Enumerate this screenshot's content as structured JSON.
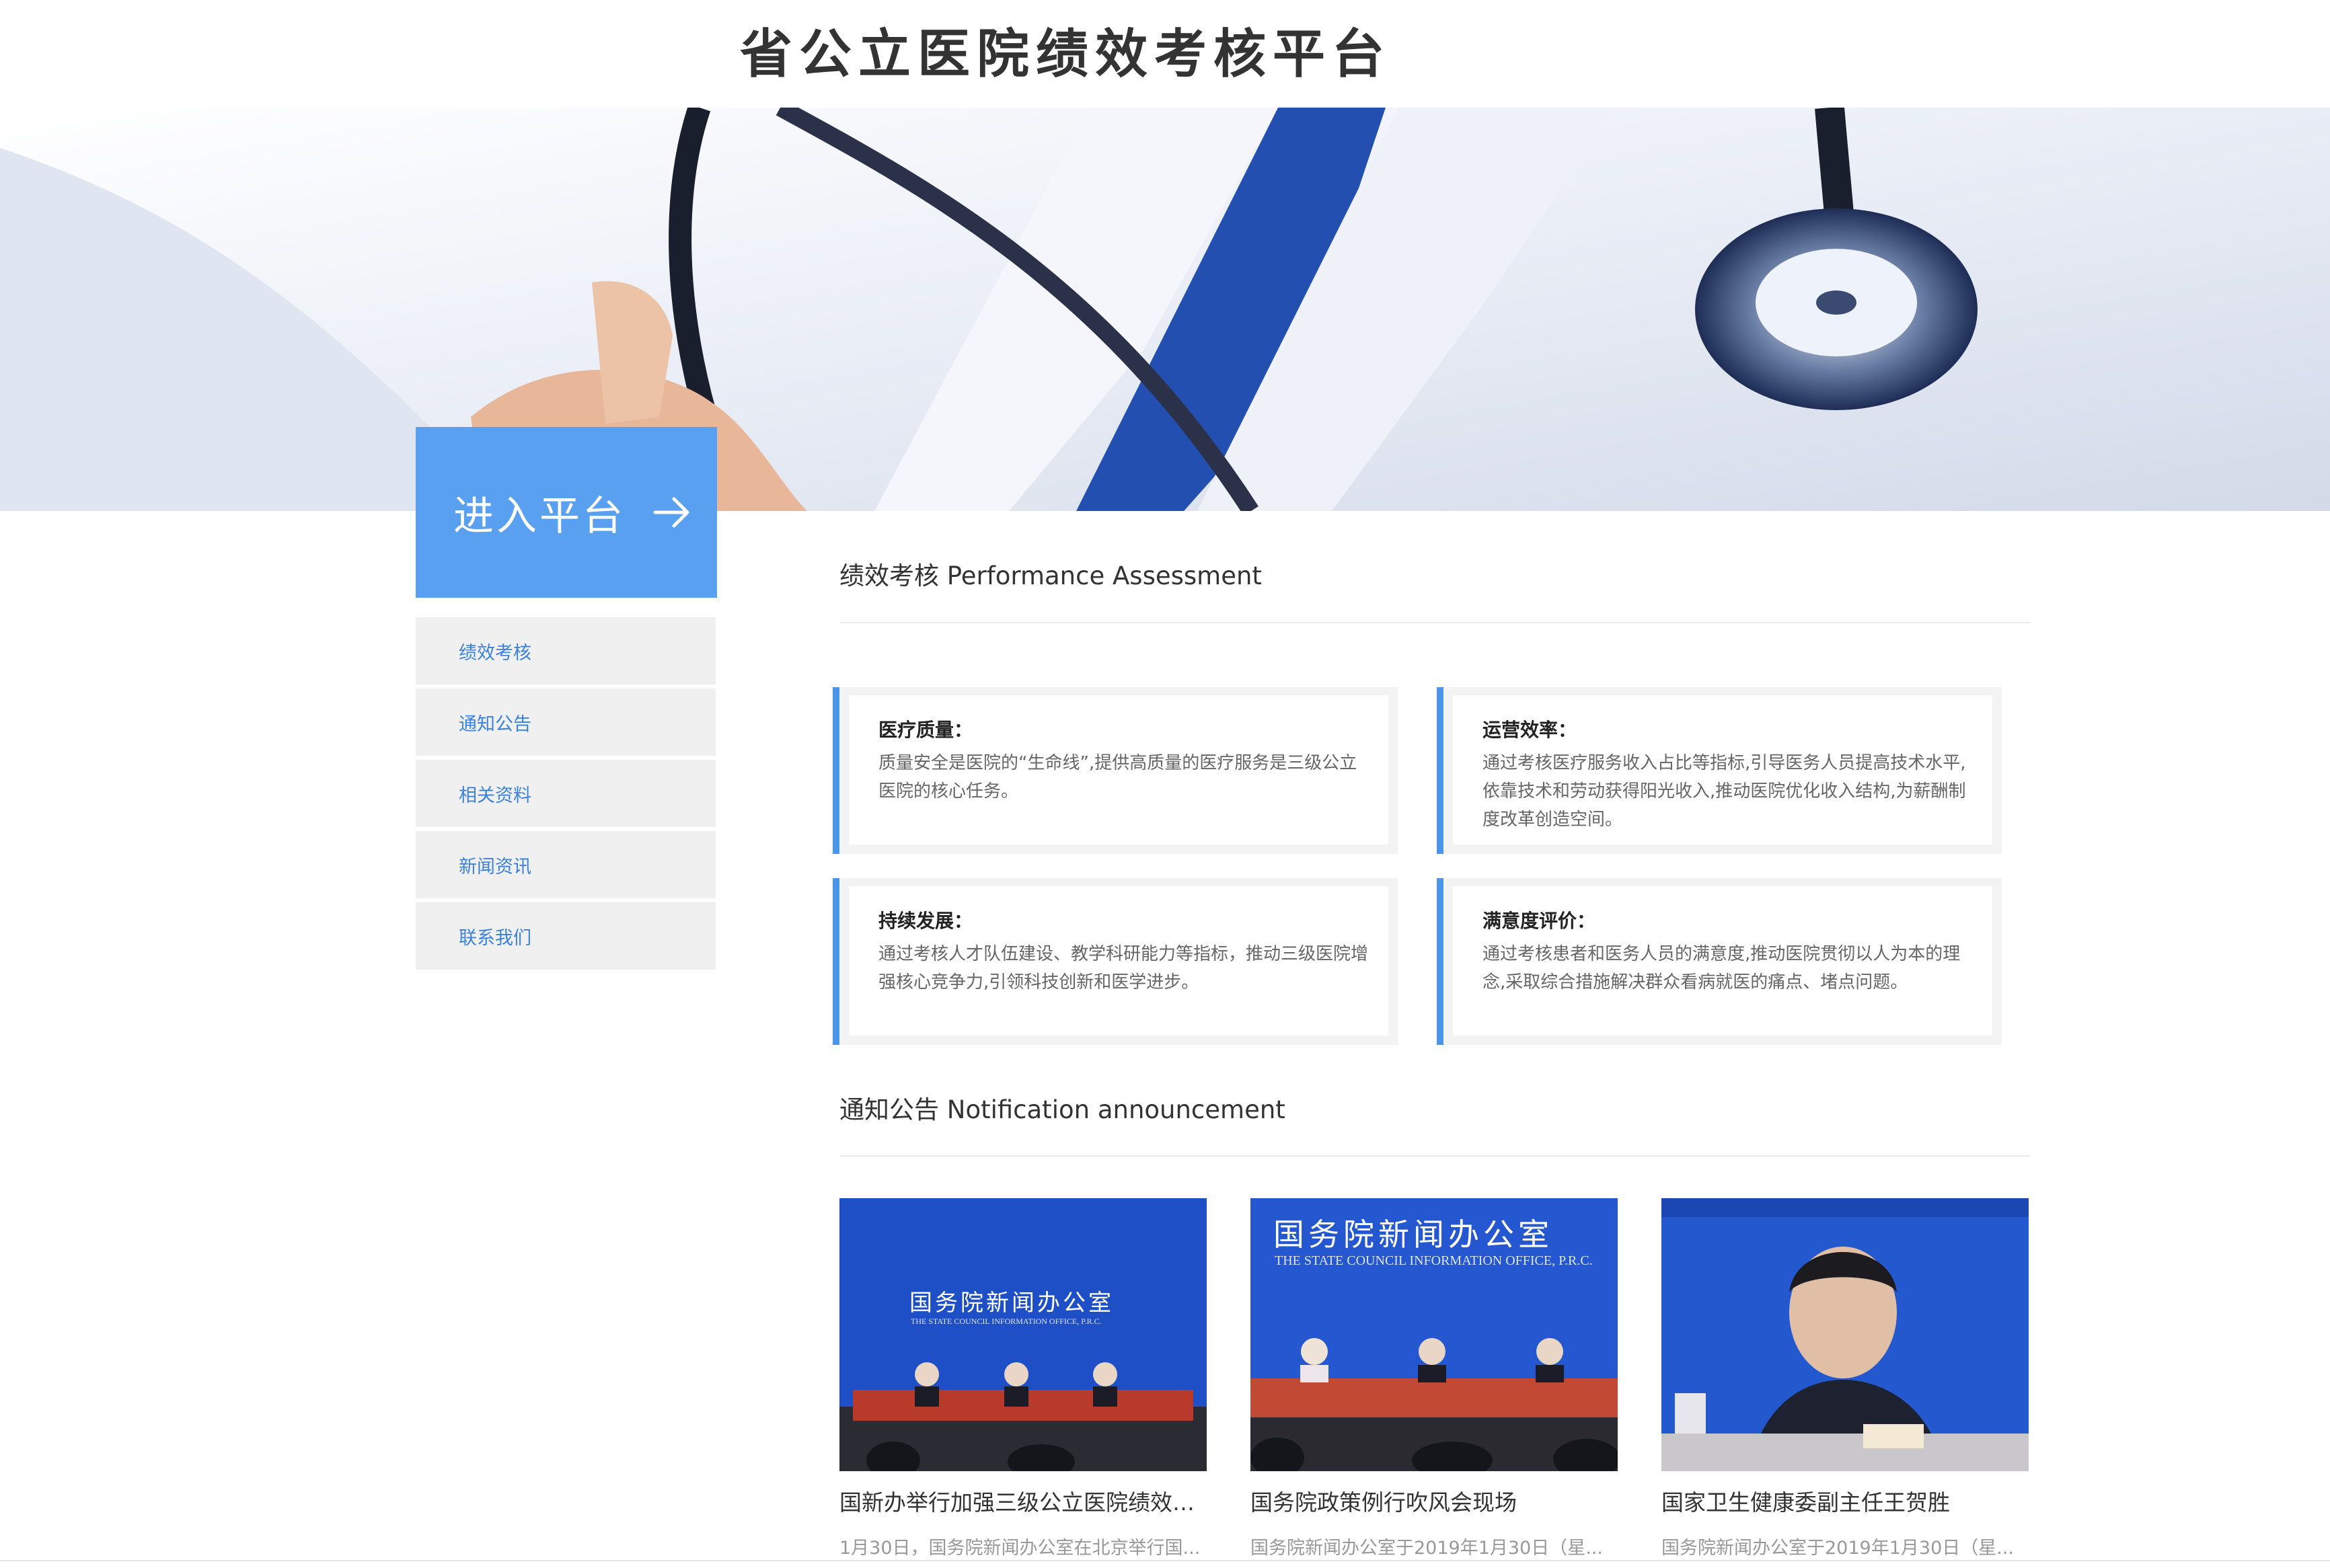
{
  "header": {
    "title": "省公立医院绩效考核平台"
  },
  "sidebar": {
    "enter_label": "进入平台",
    "items": [
      {
        "label": "绩效考核"
      },
      {
        "label": "通知公告"
      },
      {
        "label": "相关资料"
      },
      {
        "label": "新闻资讯"
      },
      {
        "label": "联系我们"
      }
    ]
  },
  "performance": {
    "heading": "绩效考核 Performance  Assessment",
    "cards": [
      {
        "title": "医疗质量：",
        "desc": "质量安全是医院的“生命线”,提供高质量的医疗服务是三级公立医院的核心任务。"
      },
      {
        "title": "运营效率：",
        "desc": "通过考核医疗服务收入占比等指标,引导医务人员提高技术水平,依靠技术和劳动获得阳光收入,推动医院优化收入结构,为薪酬制度改革创造空间。"
      },
      {
        "title": "持续发展：",
        "desc": "通过考核人才队伍建设、教学科研能力等指标，推动三级医院增强核心竞争力,引领科技创新和医学进步。"
      },
      {
        "title": "满意度评价：",
        "desc": "通过考核患者和医务人员的满意度,推动医院贯彻以人为本的理念,采取综合措施解决群众看病就医的痛点、堵点问题。"
      }
    ]
  },
  "notices": {
    "heading": "通知公告 Notification  announcement",
    "items": [
      {
        "title": "国新办举行加强三级公立医院绩效考...",
        "subtitle": "1月30日，国务院新闻办公室在北京举行国...",
        "img_text": "国务院新闻办公室",
        "img_sub": "THE STATE COUNCIL INFORMATION OFFICE, P.R.C."
      },
      {
        "title": "国务院政策例行吹风会现场",
        "subtitle": "国务院新闻办公室于2019年1月30日（星...",
        "img_text": "国务院新闻办公室",
        "img_sub": "THE STATE COUNCIL INFORMATION OFFICE, P.R.C."
      },
      {
        "title": "国家卫生健康委副主任王贺胜",
        "subtitle": "国务院新闻办公室于2019年1月30日（星..."
      }
    ]
  },
  "colors": {
    "accent": "#5aa0f0",
    "card_border": "#4a95e8",
    "nav_text": "#3b82e0"
  },
  "icons": {
    "enter": "arrow-right-icon"
  }
}
